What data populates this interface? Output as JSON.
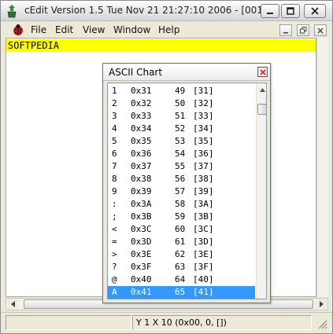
{
  "window": {
    "title": "cEdit Version 1.5 Tue Nov 21 21:27:10 2006 - [001]",
    "icon": "app-icon"
  },
  "menu": {
    "items": [
      "File",
      "Edit",
      "View",
      "Window",
      "Help"
    ]
  },
  "editor": {
    "current_line_text": "SOFTPEDIA",
    "highlight_color": "#ffff00"
  },
  "status": {
    "cell1": "",
    "cell2": "Y 1 X 10 (0x00, 0, [])"
  },
  "ascii_chart": {
    "title": "ASCII Chart",
    "rows": [
      {
        "char": "1",
        "hex": "0x31",
        "dec": "49",
        "bracket": "[31]"
      },
      {
        "char": "2",
        "hex": "0x32",
        "dec": "50",
        "bracket": "[32]"
      },
      {
        "char": "3",
        "hex": "0x33",
        "dec": "51",
        "bracket": "[33]"
      },
      {
        "char": "4",
        "hex": "0x34",
        "dec": "52",
        "bracket": "[34]"
      },
      {
        "char": "5",
        "hex": "0x35",
        "dec": "53",
        "bracket": "[35]"
      },
      {
        "char": "6",
        "hex": "0x36",
        "dec": "54",
        "bracket": "[36]"
      },
      {
        "char": "7",
        "hex": "0x37",
        "dec": "55",
        "bracket": "[37]"
      },
      {
        "char": "8",
        "hex": "0x38",
        "dec": "56",
        "bracket": "[38]"
      },
      {
        "char": "9",
        "hex": "0x39",
        "dec": "57",
        "bracket": "[39]"
      },
      {
        "char": ":",
        "hex": "0x3A",
        "dec": "58",
        "bracket": "[3A]"
      },
      {
        "char": ";",
        "hex": "0x3B",
        "dec": "59",
        "bracket": "[3B]"
      },
      {
        "char": "<",
        "hex": "0x3C",
        "dec": "60",
        "bracket": "[3C]"
      },
      {
        "char": "=",
        "hex": "0x3D",
        "dec": "61",
        "bracket": "[3D]"
      },
      {
        "char": ">",
        "hex": "0x3E",
        "dec": "62",
        "bracket": "[3E]"
      },
      {
        "char": "?",
        "hex": "0x3F",
        "dec": "63",
        "bracket": "[3F]"
      },
      {
        "char": "@",
        "hex": "0x40",
        "dec": "64",
        "bracket": "[40]"
      },
      {
        "char": "A",
        "hex": "0x41",
        "dec": "65",
        "bracket": "[41]"
      }
    ],
    "selected_index": 16,
    "selection_color": "#3399ff"
  }
}
